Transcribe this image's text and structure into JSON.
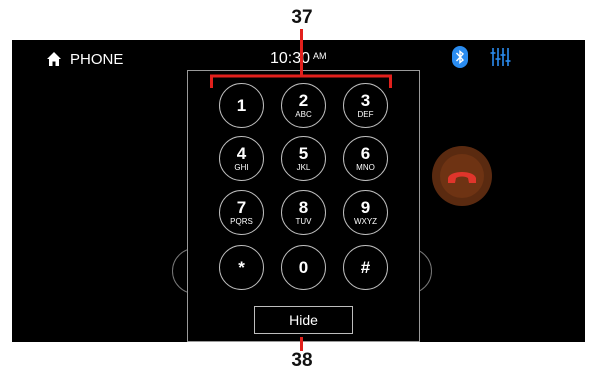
{
  "callouts": {
    "top": "37",
    "bottom": "38"
  },
  "statusbar": {
    "title": "PHONE",
    "time": "10:30",
    "ampm": "AM",
    "icons": [
      "home-icon",
      "bluetooth-icon",
      "equalizer-icon"
    ],
    "bluetooth_color": "#2a8cf0",
    "eq_color": "#2a8cf0"
  },
  "keypad": {
    "keys": [
      {
        "digit": "1",
        "letters": ""
      },
      {
        "digit": "2",
        "letters": "ABC"
      },
      {
        "digit": "3",
        "letters": "DEF"
      },
      {
        "digit": "4",
        "letters": "GHI"
      },
      {
        "digit": "5",
        "letters": "JKL"
      },
      {
        "digit": "6",
        "letters": "MNO"
      },
      {
        "digit": "7",
        "letters": "PQRS"
      },
      {
        "digit": "8",
        "letters": "TUV"
      },
      {
        "digit": "9",
        "letters": "WXYZ"
      },
      {
        "digit": "*",
        "letters": ""
      },
      {
        "digit": "0",
        "letters": ""
      },
      {
        "digit": "#",
        "letters": ""
      }
    ],
    "hide_label": "Hide"
  },
  "end_call": {
    "icon": "end-call-icon",
    "color": "#e0352b"
  },
  "callout_color": "#e2201c"
}
